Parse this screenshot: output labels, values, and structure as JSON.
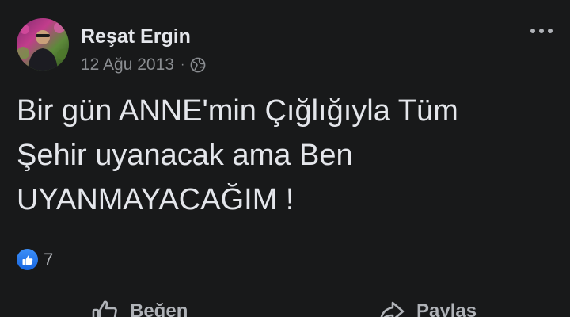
{
  "post": {
    "author": "Reşat Ergin",
    "date": "12 Ağu 2013",
    "separator": "·",
    "privacy_icon": "globe-icon",
    "menu_icon": "more-options-icon",
    "text_lines": [
      "Bir gün ANNE'min Çığlığıyla Tüm",
      "Şehir uyanacak ama Ben",
      "UYANMAYACAĞIM !"
    ],
    "reaction_icon": "like-reaction-icon",
    "reaction_count": "7"
  },
  "actions": {
    "like_label": "Beğen",
    "share_label": "Paylaş"
  },
  "colors": {
    "background": "#18191a",
    "primary_text": "#e4e6eb",
    "secondary_text": "#8a8d91",
    "like_blue": "#1877f2"
  }
}
